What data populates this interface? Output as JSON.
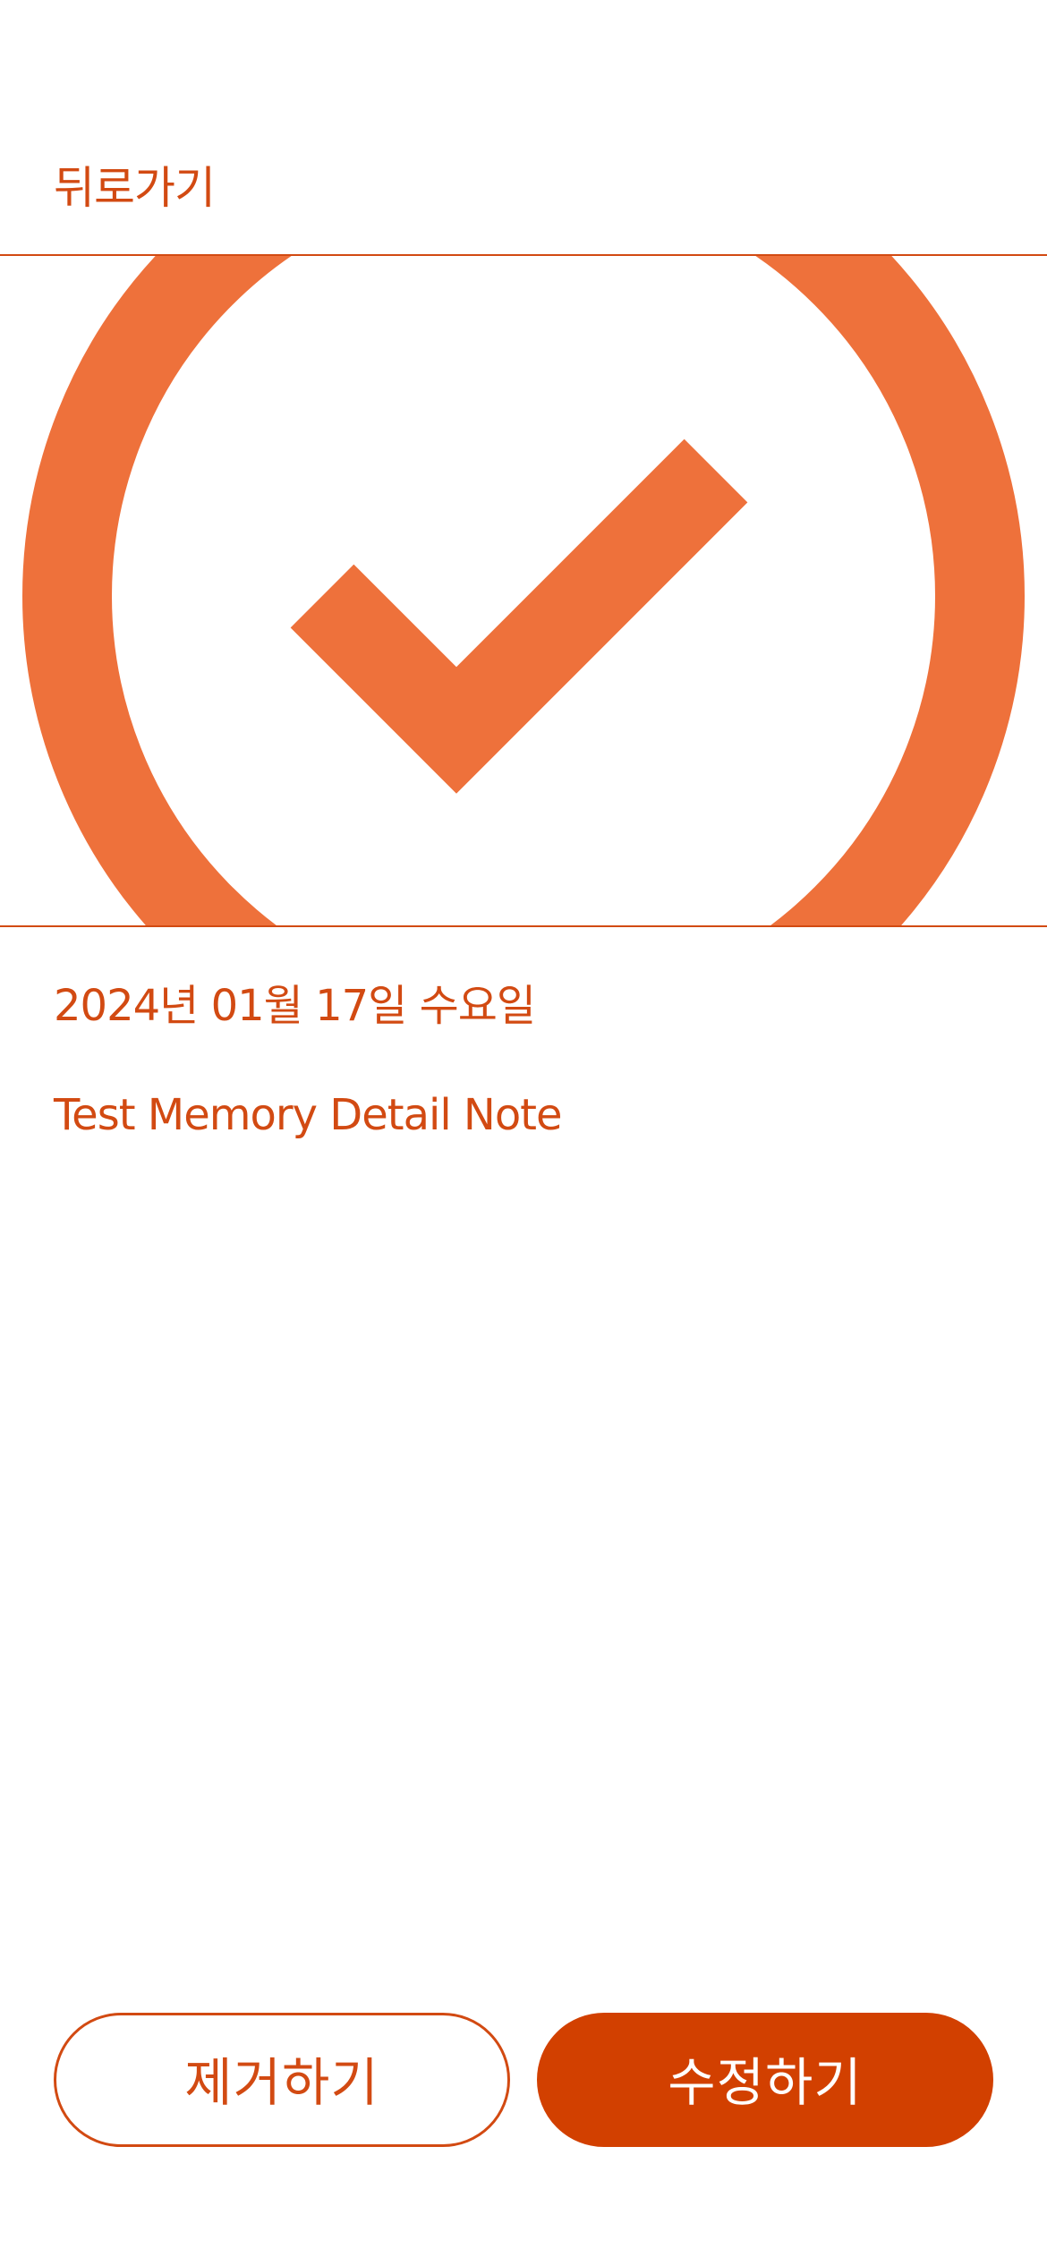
{
  "header": {
    "back_label": "뒤로가기"
  },
  "memory": {
    "date": "2024년 01월 17일 수요일",
    "note": "Test Memory Detail Note",
    "image_icon": "check-circle-icon"
  },
  "actions": {
    "remove_label": "제거하기",
    "edit_label": "수정하기"
  },
  "colors": {
    "accent": "#d24a12",
    "button_fill": "#d24000",
    "icon": "#ee713b",
    "background": "#ffffff"
  }
}
